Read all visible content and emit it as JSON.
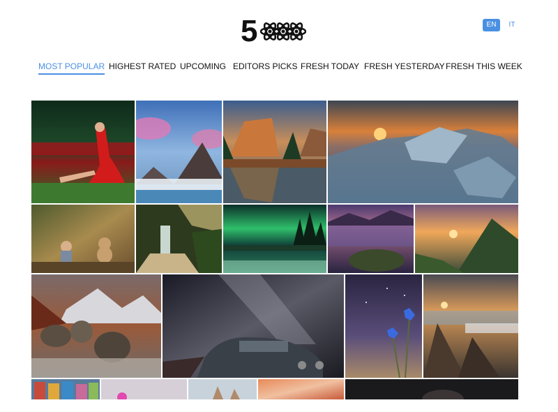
{
  "header": {
    "logo_text": "5",
    "languages": [
      {
        "label": "EN",
        "active": true
      },
      {
        "label": "IT",
        "active": false
      }
    ]
  },
  "nav": {
    "tabs": [
      {
        "label": "MOST POPULAR",
        "active": true
      },
      {
        "label": "HIGHEST RATED",
        "active": false
      },
      {
        "label": "UPCOMING",
        "active": false
      },
      {
        "label": "EDITORS PICKS",
        "active": false
      },
      {
        "label": "FRESH TODAY",
        "active": false
      },
      {
        "label": "FRESH YESTERDAY",
        "active": false
      },
      {
        "label": "FRESH THIS WEEK",
        "active": false
      }
    ]
  },
  "colors": {
    "accent": "#4a90e2",
    "text": "#111111"
  },
  "gallery": {
    "photos": [
      {
        "subject": "woman-in-red-dress-tulips"
      },
      {
        "subject": "mountain-peak-pink-clouds"
      },
      {
        "subject": "yosemite-valley-reflection"
      },
      {
        "subject": "ice-lake-sunset"
      },
      {
        "subject": "child-with-teddy-bear"
      },
      {
        "subject": "forest-waterfall"
      },
      {
        "subject": "aurora-lake"
      },
      {
        "subject": "purple-lake-mountains"
      },
      {
        "subject": "mountain-sunrise-valley"
      },
      {
        "subject": "mountain-river-boulders"
      },
      {
        "subject": "milky-way-old-car"
      },
      {
        "subject": "blue-flowers"
      },
      {
        "subject": "coastal-rocks-sunset"
      },
      {
        "subject": "colorful-buildings"
      },
      {
        "subject": "pink-flower"
      },
      {
        "subject": "rock-formations"
      },
      {
        "subject": "abstract-orange-waves"
      },
      {
        "subject": "dark-portrait"
      }
    ]
  }
}
